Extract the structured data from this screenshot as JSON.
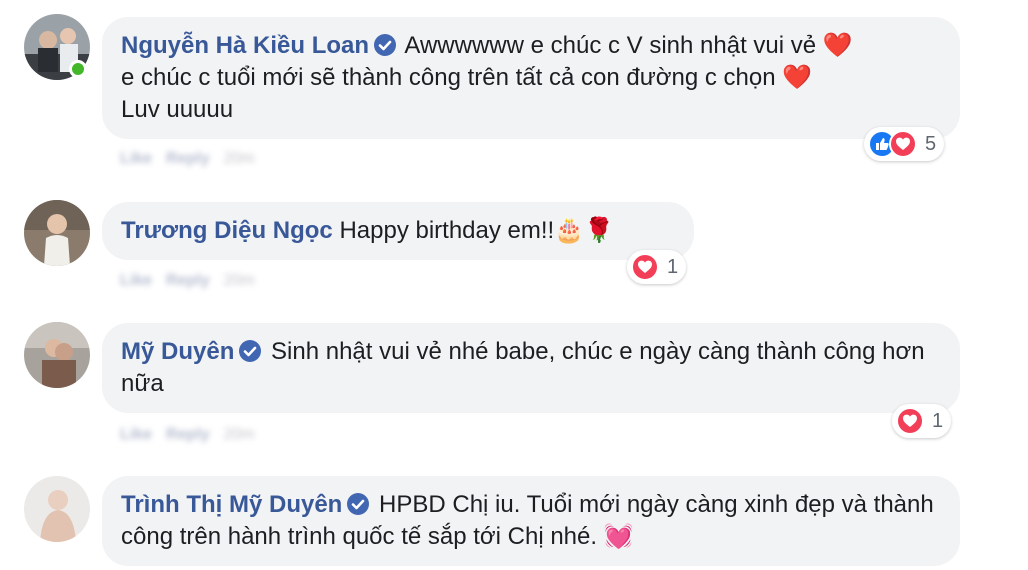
{
  "comments": [
    {
      "author": "Nguyễn Hà Kiều Loan",
      "verified": true,
      "online": true,
      "lines": [
        "Awwwwww e chúc c V sinh nhật vui vẻ ❤️",
        "e chúc c tuổi mới sẽ thành công trên tất cả con đường c chọn ❤️",
        "Luv uuuuu"
      ],
      "reactions": [
        "like",
        "love"
      ],
      "reaction_count": "5",
      "actions": {
        "like": "Like",
        "reply": "Reply",
        "time": "20m"
      }
    },
    {
      "author": "Trương Diệu Ngọc",
      "verified": false,
      "online": false,
      "text": "Happy birthday em!!🎂🌹",
      "reactions": [
        "love"
      ],
      "reaction_count": "1",
      "actions": {
        "like": "Like",
        "reply": "Reply",
        "time": "20m"
      }
    },
    {
      "author": "Mỹ Duyên",
      "verified": true,
      "online": false,
      "text": "Sinh nhật vui vẻ nhé babe, chúc e ngày càng thành công hơn nữa",
      "reactions": [
        "love"
      ],
      "reaction_count": "1",
      "actions": {
        "like": "Like",
        "reply": "Reply",
        "time": "20m"
      }
    },
    {
      "author": "Trình Thị Mỹ Duyên",
      "verified": true,
      "online": false,
      "text": "HPBD Chị iu. Tuổi mới ngày càng xinh đẹp và thành công trên hành trình quốc tế sắp tới Chị nhé. 💓"
    }
  ],
  "colors": {
    "author": "#385898",
    "bubble": "#f2f3f5",
    "verified": "#4267b2",
    "like": "#1877f2",
    "love": "#f33e58",
    "online": "#42b72a"
  }
}
